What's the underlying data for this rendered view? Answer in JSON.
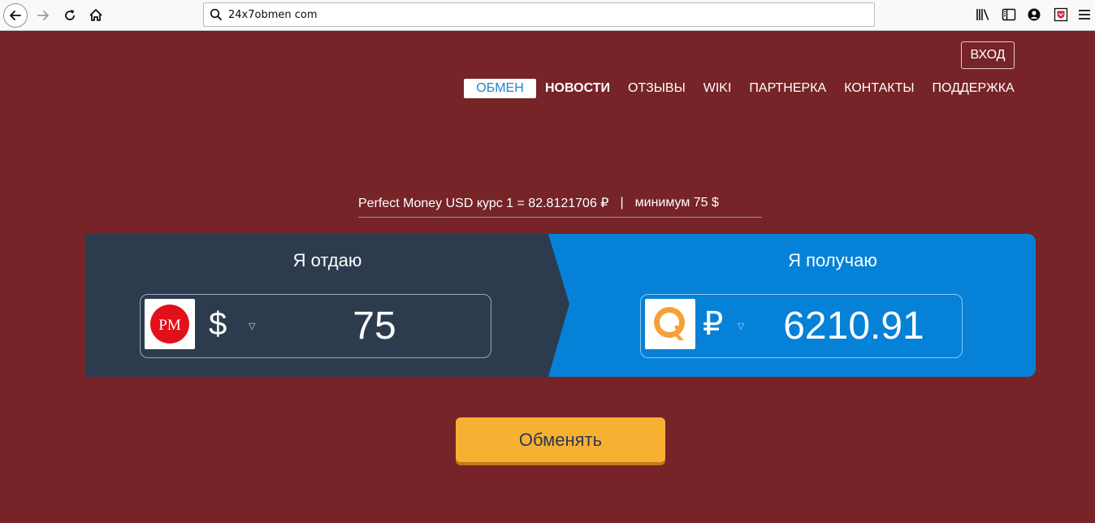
{
  "browser": {
    "url": "24x7obmen com"
  },
  "header": {
    "login_label": "ВХОД",
    "menu": [
      {
        "label": "ОБМЕН"
      },
      {
        "label": "НОВОСТИ"
      },
      {
        "label": "ОТЗЫВЫ"
      },
      {
        "label": "WIKI"
      },
      {
        "label": "ПАРТНЕРКА"
      },
      {
        "label": "КОНТАКТЫ"
      },
      {
        "label": "ПОДДЕРЖКА"
      }
    ]
  },
  "rate": {
    "text": "Perfect Money USD курс 1 = 82.8121706 ₽",
    "separator": "|",
    "minimum": "минимум 75 $"
  },
  "exchange": {
    "give": {
      "title": "Я отдаю",
      "logo_text": "PM",
      "currency_symbol": "$",
      "amount": "75"
    },
    "get": {
      "title": "Я получаю",
      "currency_symbol": "₽",
      "amount": "6210.91"
    },
    "submit_label": "Обменять"
  },
  "colors": {
    "background": "#762427",
    "give_panel": "#2c3c4e",
    "get_panel": "#0681d8",
    "button": "#f8b032",
    "active_menu": "#1e88c7"
  },
  "icons": {
    "back": "back-arrow-icon",
    "forward": "forward-arrow-icon",
    "reload": "reload-icon",
    "home": "home-icon",
    "search": "search-icon",
    "library": "library-icon",
    "sidebar": "sidebar-icon",
    "account": "account-icon",
    "pocket": "pocket-icon",
    "menu": "hamburger-menu-icon",
    "dropdown": "dropdown-triangle-icon",
    "perfect_money": "perfect-money-logo",
    "qiwi": "qiwi-logo"
  }
}
